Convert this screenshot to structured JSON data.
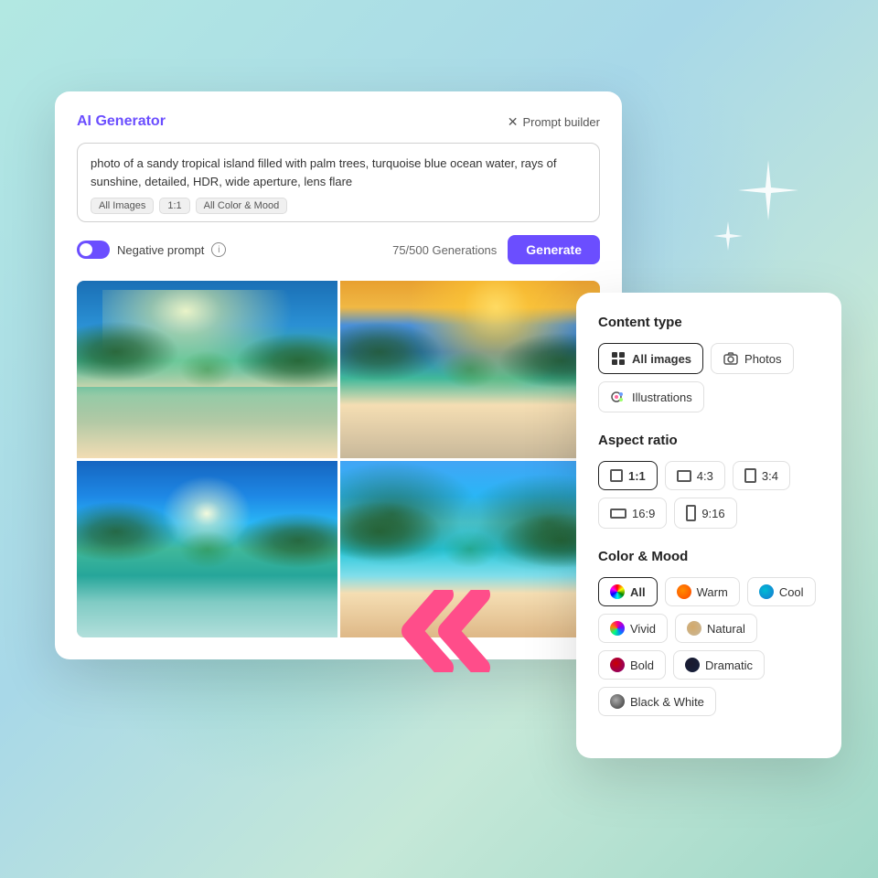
{
  "background": {
    "color": "#b2e8e2"
  },
  "ai_generator_card": {
    "title": "AI Generator",
    "prompt_builder_label": "Prompt builder",
    "prompt_text": "photo of a sandy tropical island filled with palm trees, turquoise blue ocean water, rays of sunshine, detailed, HDR, wide aperture, lens flare",
    "tags": [
      "All Images",
      "1:1",
      "All Color & Mood"
    ],
    "negative_prompt_label": "Negative prompt",
    "generations_text": "75/500 Generations",
    "generate_label": "Generate"
  },
  "prompt_builder_panel": {
    "content_type": {
      "title": "Content type",
      "options": [
        {
          "label": "All images",
          "icon": "grid-icon",
          "active": true
        },
        {
          "label": "Photos",
          "icon": "camera-icon",
          "active": false
        },
        {
          "label": "Illustrations",
          "icon": "brush-icon",
          "active": false
        }
      ]
    },
    "aspect_ratio": {
      "title": "Aspect ratio",
      "options": [
        {
          "label": "1:1",
          "ratio": "1-1",
          "active": true
        },
        {
          "label": "4:3",
          "ratio": "4-3",
          "active": false
        },
        {
          "label": "3:4",
          "ratio": "3-4",
          "active": false
        },
        {
          "label": "16:9",
          "ratio": "16-9",
          "active": false
        },
        {
          "label": "9:16",
          "ratio": "9-16",
          "active": false
        }
      ]
    },
    "color_mood": {
      "title": "Color & Mood",
      "options": [
        {
          "label": "All",
          "color": "all",
          "active": true
        },
        {
          "label": "Warm",
          "color": "warm",
          "active": false
        },
        {
          "label": "Cool",
          "color": "cool",
          "active": false
        },
        {
          "label": "Vivid",
          "color": "vivid",
          "active": false
        },
        {
          "label": "Natural",
          "color": "natural",
          "active": false
        },
        {
          "label": "Bold",
          "color": "bold",
          "active": false
        },
        {
          "label": "Dramatic",
          "color": "dramatic",
          "active": false
        },
        {
          "label": "Black & White",
          "color": "bw",
          "active": false
        }
      ]
    }
  }
}
